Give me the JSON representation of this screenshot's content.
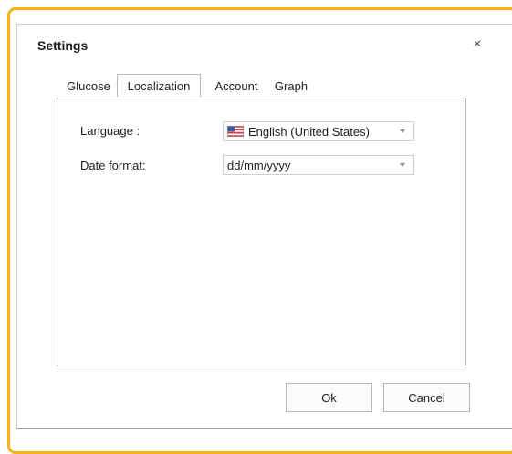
{
  "dialog": {
    "title": "Settings",
    "close_label": "×"
  },
  "tabs": [
    {
      "label": "Glucose",
      "active": false
    },
    {
      "label": "Localization",
      "active": true
    },
    {
      "label": "Account",
      "active": false
    },
    {
      "label": "Graph",
      "active": false
    }
  ],
  "localization": {
    "language_label": "Language :",
    "language_value": "English (United States)",
    "language_flag_icon": "us-flag-icon",
    "date_format_label": "Date format:",
    "date_format_value": "dd/mm/yyyy"
  },
  "buttons": {
    "ok_label": "Ok",
    "cancel_label": "Cancel"
  },
  "colors": {
    "frame_accent": "#f5b21b"
  }
}
